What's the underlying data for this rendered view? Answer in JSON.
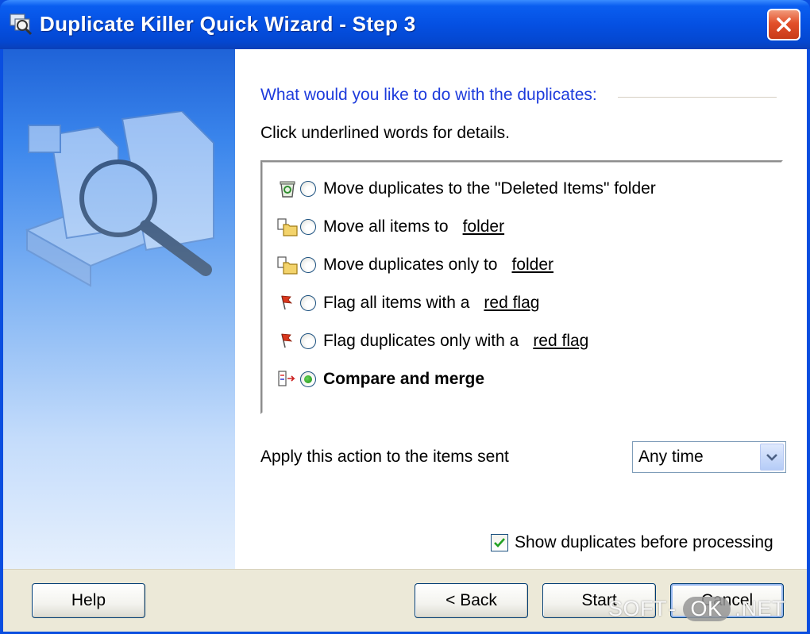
{
  "window": {
    "title": "Duplicate Killer Quick Wizard - Step 3",
    "close_icon": "close-x-icon"
  },
  "wizard": {
    "question": "What would you like to do with the duplicates:",
    "hint": "Click underlined words for details.",
    "options": [
      {
        "icon": "deleted-items-icon",
        "label": "Move duplicates to the \"Deleted Items\" folder",
        "link": "",
        "selected": false,
        "bold": false
      },
      {
        "icon": "folder-move-icon",
        "label": "Move all items to",
        "link": "folder",
        "selected": false,
        "bold": false
      },
      {
        "icon": "folder-move-icon",
        "label": "Move duplicates only to",
        "link": "folder",
        "selected": false,
        "bold": false
      },
      {
        "icon": "red-flag-icon",
        "label": "Flag all items with a",
        "link": "red flag",
        "selected": false,
        "bold": false
      },
      {
        "icon": "red-flag-icon",
        "label": "Flag duplicates only with a",
        "link": "red flag",
        "selected": false,
        "bold": false
      },
      {
        "icon": "compare-merge-icon",
        "label": "Compare and merge",
        "link": "",
        "selected": true,
        "bold": true
      }
    ],
    "apply_label": "Apply this action to the items sent",
    "apply_select": {
      "value": "Any time"
    },
    "show_duplicates": {
      "label": "Show duplicates before processing",
      "checked": true
    }
  },
  "buttons": {
    "help": "Help",
    "back": "< Back",
    "start": "Start",
    "cancel": "Cancel"
  },
  "watermark": {
    "part1": "SOFT",
    "part2": "OK",
    "part3": ".NET"
  }
}
